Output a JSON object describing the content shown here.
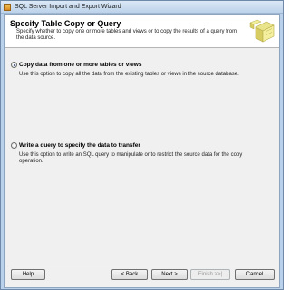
{
  "window": {
    "title": "SQL Server Import and Export Wizard"
  },
  "header": {
    "title": "Specify Table Copy or Query",
    "description": "Specify whether to copy one or more tables and views or to copy the results of a query from the data source."
  },
  "options": [
    {
      "label": "Copy data from one or more tables or views",
      "description": "Use this option to copy all the data from the existing tables or views in the source database.",
      "selected": true
    },
    {
      "label": "Write a query to specify the data to transfer",
      "description": "Use this option to write an SQL query to manipulate or to restrict the source data for the copy operation.",
      "selected": false
    }
  ],
  "buttons": {
    "help": "Help",
    "back": "< Back",
    "next": "Next >",
    "finish": "Finish >>|",
    "cancel": "Cancel"
  },
  "colors": {
    "window_frame": "#b9d1ea",
    "client_bg": "#f0f0f0",
    "header_bg": "#ffffff"
  }
}
